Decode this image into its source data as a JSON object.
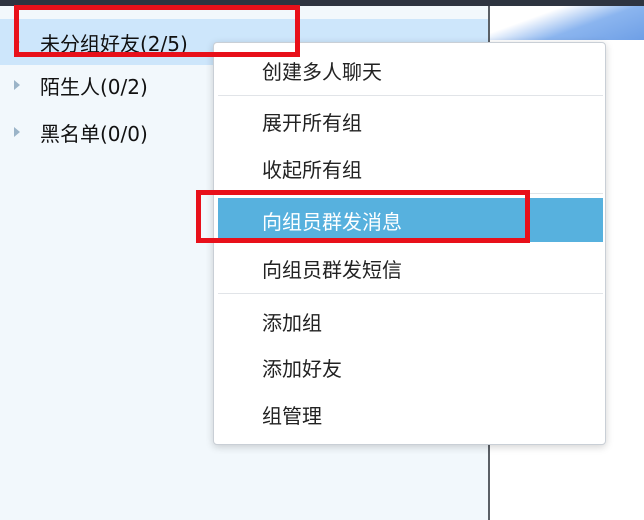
{
  "groups": [
    {
      "label": "未分组好友(2/5)",
      "selected": true
    },
    {
      "label": "陌生人(0/2)",
      "selected": false
    },
    {
      "label": "黑名单(0/0)",
      "selected": false
    }
  ],
  "context_menu": {
    "sections": [
      [
        "创建多人聊天"
      ],
      [
        "展开所有组",
        "收起所有组"
      ],
      [
        "向组员群发消息",
        "向组员群发短信"
      ],
      [
        "添加组",
        "添加好友",
        "组管理"
      ]
    ],
    "active_item": "向组员群发消息"
  },
  "colors": {
    "highlight_box": "#e8101a",
    "menu_active_bg": "#57b1de",
    "selected_row_bg": "#cde6fb",
    "panel_bg": "#f2f8fc"
  }
}
